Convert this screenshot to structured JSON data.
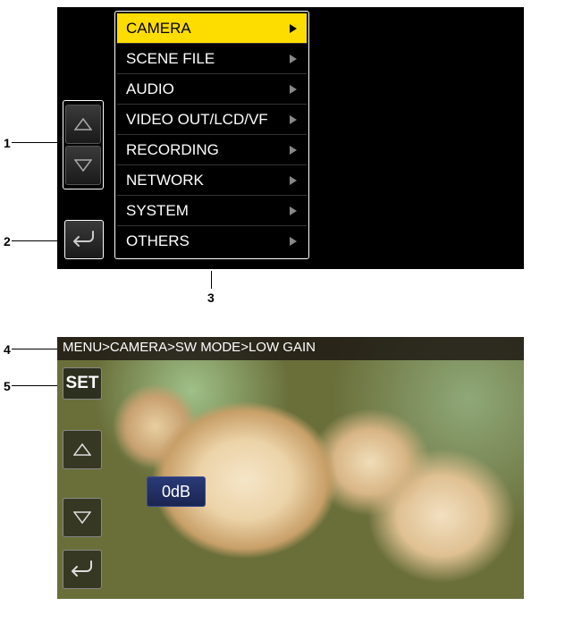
{
  "annotations": {
    "a1": "1",
    "a2": "2",
    "a3": "3",
    "a4": "4",
    "a5": "5"
  },
  "menu": {
    "items": [
      {
        "label": "CAMERA",
        "selected": true
      },
      {
        "label": "SCENE FILE",
        "selected": false
      },
      {
        "label": "AUDIO",
        "selected": false
      },
      {
        "label": "VIDEO OUT/LCD/VF",
        "selected": false
      },
      {
        "label": "RECORDING",
        "selected": false
      },
      {
        "label": "NETWORK",
        "selected": false
      },
      {
        "label": "SYSTEM",
        "selected": false
      },
      {
        "label": "OTHERS",
        "selected": false
      }
    ]
  },
  "preview": {
    "breadcrumb": "MENU>CAMERA>SW MODE>LOW GAIN",
    "set_label": "SET",
    "value": "0dB"
  }
}
